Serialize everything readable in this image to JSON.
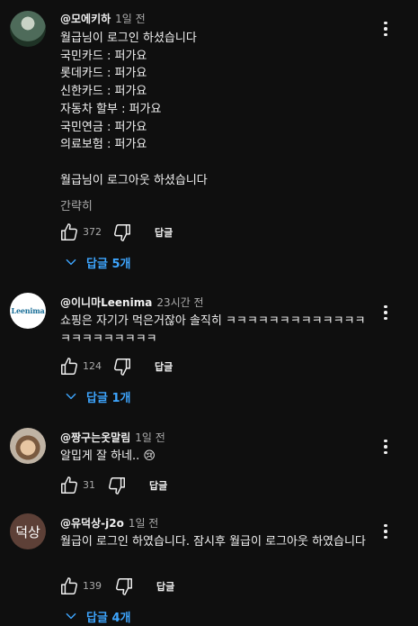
{
  "comments": [
    {
      "author": "@모에키하",
      "time": "1일 전",
      "body": "월급님이 로그인 하셨습니다\n국민카드 : 퍼가요\n롯데카드 : 퍼가요\n신한카드 : 퍼가요\n자동차 할부 : 퍼가요\n국민연금 : 퍼가요\n의료보험 : 퍼가요\n\n월급님이 로그아웃 하셨습니다",
      "read_more": "간략히",
      "likes": "372",
      "reply_label": "답글",
      "replies_label": "답글 5개"
    },
    {
      "author": "@이니마Leenima",
      "time": "23시간 전",
      "avatar_text": "Leenima",
      "body": "쇼핑은 자기가 먹은거잖아 솔직히 ㅋㅋㅋㅋㅋㅋㅋㅋㅋㅋㅋㅋㅋㅋㅋㅋㅋㅋㅋㅋㅋㅋ",
      "likes": "124",
      "reply_label": "답글",
      "replies_label": "답글 1개"
    },
    {
      "author": "@짱구는옷말림",
      "time": "1일 전",
      "body": "알밉게 잘 하네.. 😢",
      "likes": "31",
      "reply_label": "답글"
    },
    {
      "author": "@유덕상-j2o",
      "time": "1일 전",
      "avatar_text": "덕상",
      "body": "월급이 로그인 하였습니다. 잠시후 월급이 로그아웃 하였습니다",
      "likes": "139",
      "reply_label": "답글",
      "replies_label": "답글 4개"
    }
  ],
  "colors": {
    "background": "#0f0f0f",
    "text": "#f1f1f1",
    "secondary": "#aaaaaa",
    "link": "#3ea6ff"
  }
}
